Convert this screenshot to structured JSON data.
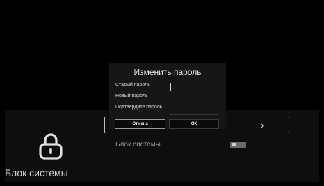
{
  "settings": {
    "side_title": "Блок системы",
    "row_chevron": "›",
    "system_lock_label": "Блок системы"
  },
  "dialog": {
    "title": "Изменить пароль",
    "fields": [
      {
        "label": "Старый пароль",
        "value": ""
      },
      {
        "label": "Новый пароль",
        "value": ""
      },
      {
        "label": "Подтвердите пароль",
        "value": ""
      }
    ],
    "cancel_label": "Отмена",
    "ok_label": "ОК"
  },
  "colors": {
    "accent_line": "#3d7bd6",
    "background": "#000000"
  },
  "icons": {
    "lock": "lock-icon",
    "chevron": "chevron-right-icon"
  }
}
